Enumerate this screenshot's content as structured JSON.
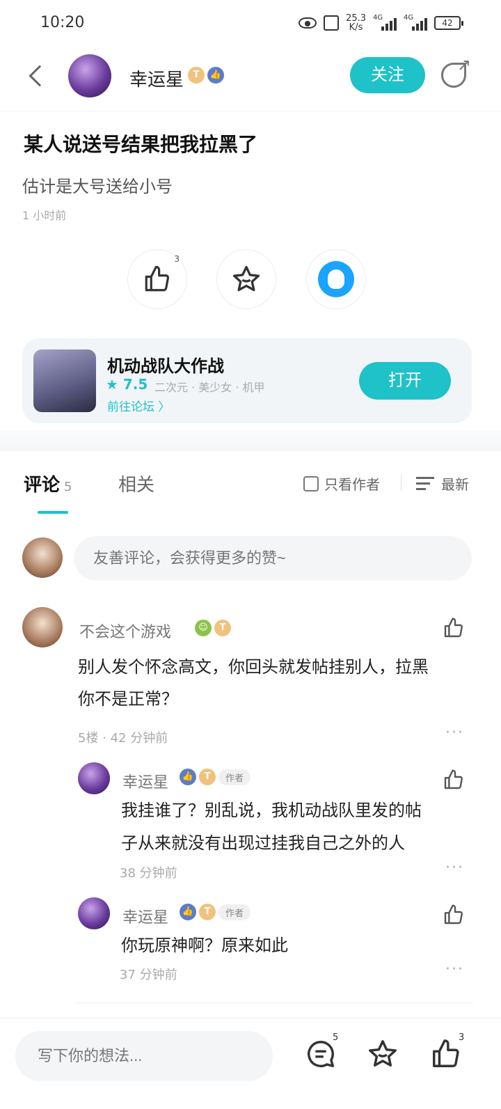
{
  "status": {
    "time": "10:20",
    "speed_top": "25.3",
    "speed_unit": "K/s",
    "net1": "4G",
    "net2": "4G",
    "battery": "42"
  },
  "header": {
    "author_name": "幸运星",
    "badge_t": "T",
    "follow_label": "关注"
  },
  "post": {
    "title": "某人说送号结果把我拉黑了",
    "subtitle": "估计是大号送给小号",
    "time": "1 小时前",
    "like_count": "3"
  },
  "game": {
    "name": "机动战队大作战",
    "rating": "★ 7.5",
    "tags": "二次元 · 美少女 · 机甲",
    "forum_link": "前往论坛 〉",
    "open_label": "打开"
  },
  "tabs": {
    "comments_label": "评论",
    "comments_count": "5",
    "related_label": "相关",
    "author_only_label": "只看作者",
    "sort_label": "最新"
  },
  "comment_input": {
    "placeholder": "友善评论，会获得更多的赞~"
  },
  "comments": [
    {
      "name": "不会这个游戏",
      "text_line1": "别人发个怀念高文，你回头就发帖挂别人，拉黑",
      "text_line2": "你不是正常？",
      "meta": "5楼 · 42 分钟前"
    }
  ],
  "replies": [
    {
      "name": "幸运星",
      "author_tag": "作者",
      "text_line1": "我挂谁了？别乱说，我机动战队里发的帖",
      "text_line2": "子从来就没有出现过挂我自己之外的人",
      "meta": "38 分钟前"
    },
    {
      "name": "幸运星",
      "author_tag": "作者",
      "text_line1": "你玩原神啊？原来如此",
      "meta": "37 分钟前"
    }
  ],
  "bottom": {
    "placeholder": "写下你的想法...",
    "comment_count": "5",
    "like_count": "3"
  },
  "colors": {
    "accent": "#1ec2c8",
    "badge_gold": "#f1c27d",
    "badge_blue": "#5b7cc9"
  }
}
